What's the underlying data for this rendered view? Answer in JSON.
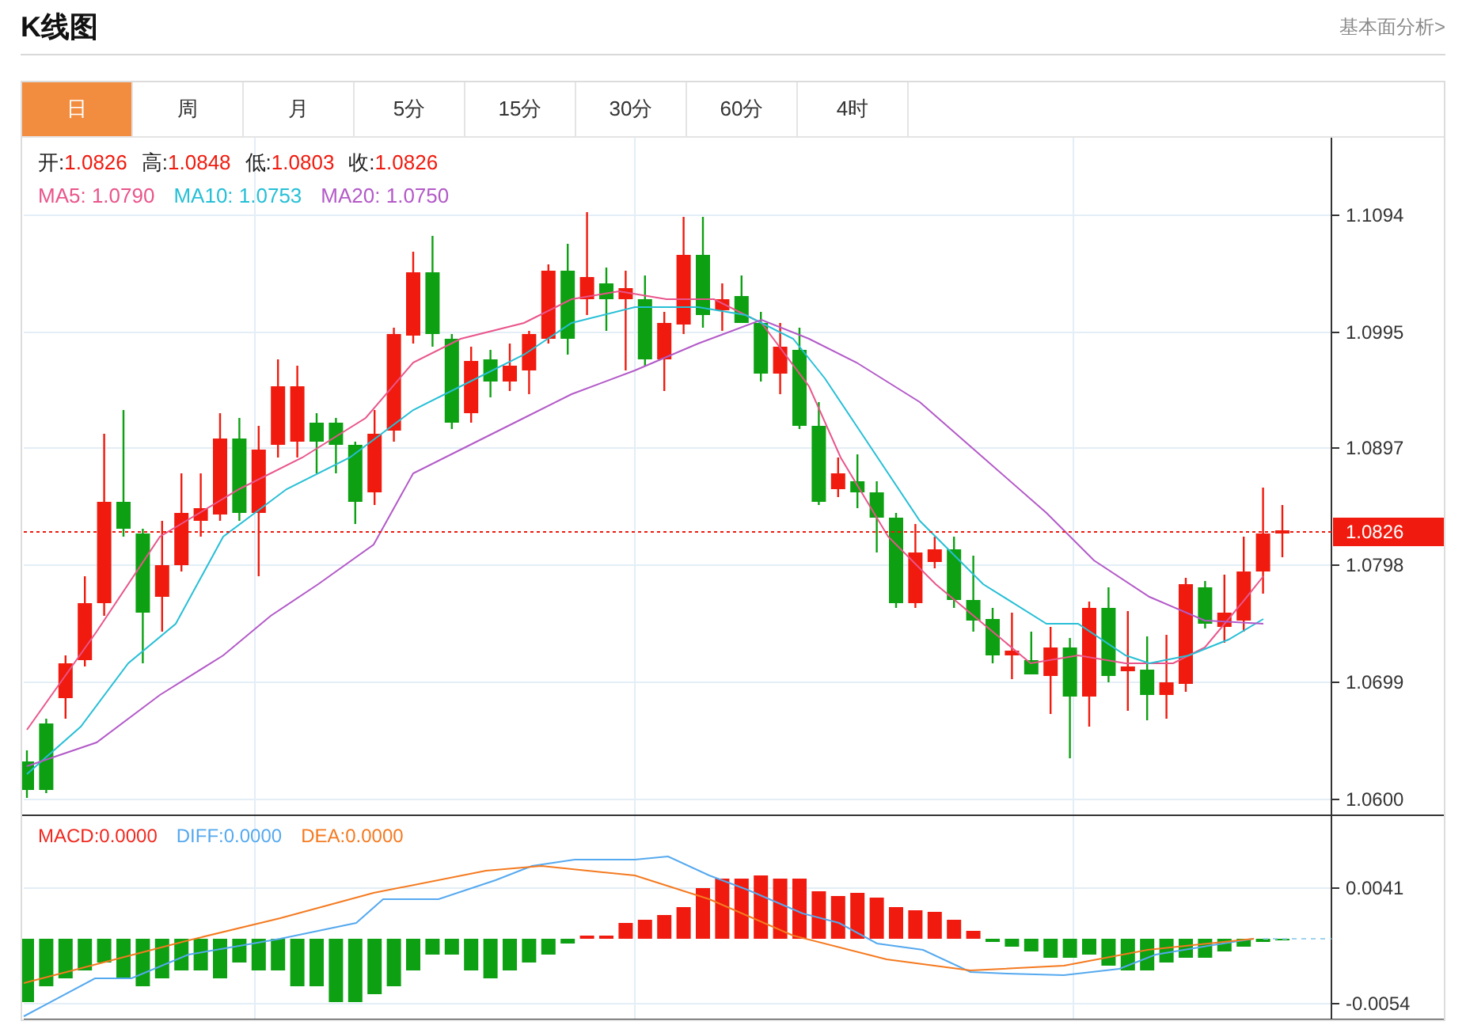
{
  "header": {
    "title": "K线图",
    "link": "基本面分析>"
  },
  "tabs": [
    {
      "label": "日",
      "selected": true
    },
    {
      "label": "周",
      "selected": false
    },
    {
      "label": "月",
      "selected": false
    },
    {
      "label": "5分",
      "selected": false
    },
    {
      "label": "15分",
      "selected": false
    },
    {
      "label": "30分",
      "selected": false
    },
    {
      "label": "60分",
      "selected": false
    },
    {
      "label": "4时",
      "selected": false
    }
  ],
  "ohlc": [
    {
      "label": "开:",
      "value": "1.0826"
    },
    {
      "label": "高:",
      "value": "1.0848"
    },
    {
      "label": "低:",
      "value": "1.0803"
    },
    {
      "label": "收:",
      "value": "1.0826"
    }
  ],
  "ma_legend": [
    {
      "text": "MA5: 1.0790",
      "color": "#e9558b"
    },
    {
      "text": "MA10: 1.0753",
      "color": "#27bfd6"
    },
    {
      "text": "MA20: 1.0750",
      "color": "#b35ac8"
    }
  ],
  "price_axis": [
    "1.1094",
    "1.0995",
    "1.0897",
    "1.0798",
    "1.0699",
    "1.0600"
  ],
  "current_price": "1.0826",
  "macd_legend": [
    {
      "text": "MACD:0.0000",
      "color": "#f0281e"
    },
    {
      "text": "DIFF:0.0000",
      "color": "#55a9ef"
    },
    {
      "text": "DEA:0.0000",
      "color": "#f47a20"
    }
  ],
  "macd_axis": [
    "0.0041",
    "-0.0054"
  ]
}
